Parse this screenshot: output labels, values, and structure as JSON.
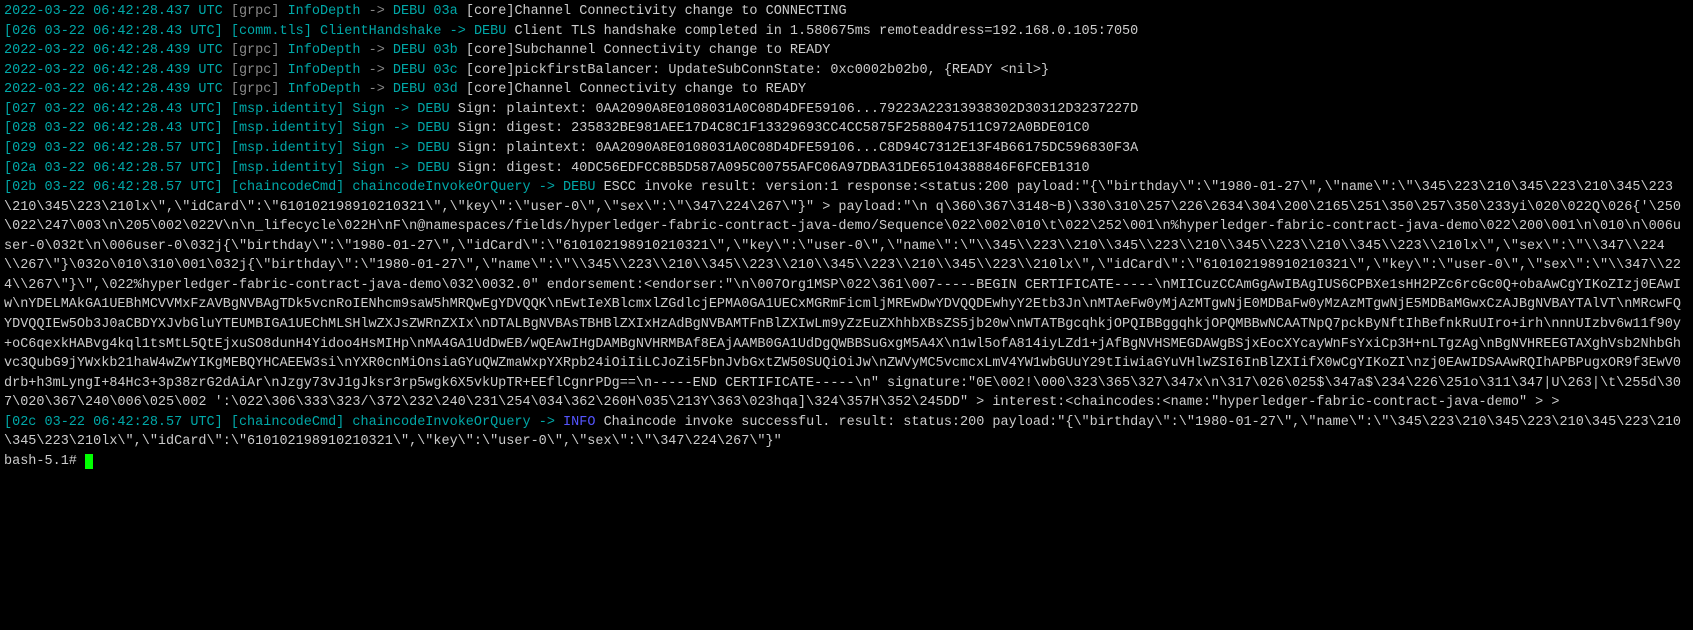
{
  "lines": [
    {
      "pre": "",
      "ts": "2022-03-22 06:42:28.437 UTC",
      "tag": "[grpc]",
      "mod": "InfoDepth",
      "arr": "->",
      "lvl": "DEBU",
      "lvlx": "03a",
      "msg": "[core]Channel Connectivity change to CONNECTING",
      "dim": false,
      "style": "norm"
    },
    {
      "pre": "[026 03-22 06:42:28.43 UTC]",
      "tag": "[comm.tls]",
      "mod": "ClientHandshake",
      "arr": "->",
      "lvl": "DEBU",
      "lvlx": "",
      "msg": "Client TLS handshake completed in 1.580675ms remoteaddress=192.168.0.105:7050",
      "style": "brk"
    },
    {
      "pre": "",
      "ts": "2022-03-22 06:42:28.439 UTC",
      "tag": "[grpc]",
      "mod": "InfoDepth",
      "arr": "->",
      "lvl": "DEBU",
      "lvlx": "03b",
      "msg": "[core]Subchannel Connectivity change to READY",
      "style": "norm"
    },
    {
      "pre": "",
      "ts": "2022-03-22 06:42:28.439 UTC",
      "tag": "[grpc]",
      "mod": "InfoDepth",
      "arr": "->",
      "lvl": "DEBU",
      "lvlx": "03c",
      "msg": "[core]pickfirstBalancer: UpdateSubConnState: 0xc0002b02b0, {READY <nil>}",
      "style": "norm"
    },
    {
      "pre": "",
      "ts": "2022-03-22 06:42:28.439 UTC",
      "tag": "[grpc]",
      "mod": "InfoDepth",
      "arr": "->",
      "lvl": "DEBU",
      "lvlx": "03d",
      "msg": "[core]Channel Connectivity change to READY",
      "style": "norm"
    },
    {
      "pre": "[027 03-22 06:42:28.43 UTC]",
      "tag": "[msp.identity]",
      "mod": "Sign",
      "arr": "->",
      "lvl": "DEBU",
      "lvlx": "",
      "msg": "Sign: plaintext: 0AA2090A8E0108031A0C08D4DFE59106...79223A22313938302D30312D3237227D",
      "style": "brk"
    },
    {
      "pre": "[028 03-22 06:42:28.43 UTC]",
      "tag": "[msp.identity]",
      "mod": "Sign",
      "arr": "->",
      "lvl": "DEBU",
      "lvlx": "",
      "msg": "Sign: digest: 235832BE981AEE17D4C8C1F13329693CC4CC5875F2588047511C972A0BDE01C0",
      "style": "brk"
    },
    {
      "pre": "[029 03-22 06:42:28.57 UTC]",
      "tag": "[msp.identity]",
      "mod": "Sign",
      "arr": "->",
      "lvl": "DEBU",
      "lvlx": "",
      "msg": "Sign: plaintext: 0AA2090A8E0108031A0C08D4DFE59106...C8D94C7312E13F4B66175DC596830F3A",
      "style": "brk"
    },
    {
      "pre": "[02a 03-22 06:42:28.57 UTC]",
      "tag": "[msp.identity]",
      "mod": "Sign",
      "arr": "->",
      "lvl": "DEBU",
      "lvlx": "",
      "msg": "Sign: digest: 40DC56EDFCC8B5D587A095C00755AFC06A97DBA31DE65104388846F6FCEB1310",
      "style": "brk"
    }
  ],
  "escc": {
    "pre": "[02b 03-22 06:42:28.57 UTC]",
    "tag": "[chaincodeCmd]",
    "mod": "chaincodeInvokeOrQuery",
    "arr": "->",
    "lvl": "DEBU",
    "msg": "ESCC invoke result: version:1 response:<status:200 payload:\"{\\\"birthday\\\":\\\"1980-01-27\\\",\\\"name\\\":\\\"\\345\\223\\210\\345\\223\\210\\345\\223\\210\\345\\223\\210lx\\\",\\\"idCard\\\":\\\"610102198910210321\\\",\\\"key\\\":\\\"user-0\\\",\\\"sex\\\":\\\"\\347\\224\\267\\\"}\" > payload:\"\\n q\\360\\367\\3148~B)\\330\\310\\257\\226\\2634\\304\\200\\2165\\251\\350\\257\\350\\233yi\\020\\022Q\\026{'\\250\\022\\247\\003\\n\\205\\002\\022V\\n\\n_lifecycle\\022H\\nF\\n@namespaces/fields/hyperledger-fabric-contract-java-demo/Sequence\\022\\002\\010\\t\\022\\252\\001\\n%hyperledger-fabric-contract-java-demo\\022\\200\\001\\n\\010\\n\\006user-0\\032t\\n\\006user-0\\032j{\\\"birthday\\\":\\\"1980-01-27\\\",\\\"idCard\\\":\\\"610102198910210321\\\",\\\"key\\\":\\\"user-0\\\",\\\"name\\\":\\\"\\\\345\\\\223\\\\210\\\\345\\\\223\\\\210\\\\345\\\\223\\\\210\\\\345\\\\223\\\\210lx\\\",\\\"sex\\\":\\\"\\\\347\\\\224\\\\267\\\"}\\032o\\010\\310\\001\\032j{\\\"birthday\\\":\\\"1980-01-27\\\",\\\"name\\\":\\\"\\\\345\\\\223\\\\210\\\\345\\\\223\\\\210\\\\345\\\\223\\\\210\\\\345\\\\223\\\\210lx\\\",\\\"idCard\\\":\\\"610102198910210321\\\",\\\"key\\\":\\\"user-0\\\",\\\"sex\\\":\\\"\\\\347\\\\224\\\\267\\\"}\\\",\\022%hyperledger-fabric-contract-java-demo\\032\\0032.0\" endorsement:<endorser:\"\\n\\007Org1MSP\\022\\361\\007-----BEGIN CERTIFICATE-----\\nMIICuzCCAmGgAwIBAgIUS6CPBXe1sHH2PZc6rcGc0Q+obaAwCgYIKoZIzj0EAwIw\\nYDELMAkGA1UEBhMCVVMxFzAVBgNVBAgTDk5vcnRoIENhcm9saW5hMRQwEgYDVQQK\\nEwtIeXBlcmxlZGdlcjEPMA0GA1UECxMGRmFicmljMREwDwYDVQQDEwhyY2Etb3Jn\\nMTAeFw0yMjAzMTgwNjE0MDBaFw0yMzAzMTgwNjE5MDBaMGwxCzAJBgNVBAYTAlVT\\nMRcwFQYDVQQIEw5Ob3J0aCBDYXJvbGluYTEUMBIGA1UEChMLSHlwZXJsZWRnZXIx\\nDTALBgNVBAsTBHBlZXIxHzAdBgNVBAMTFnBlZXIwLm9yZzEuZXhhbXBsZS5jb20w\\nWTATBgcqhkjOPQIBBggqhkjOPQMBBwNCAATNpQ7pckByNftIhBefnkRuUIro+irh\\nnnUIzbv6w11f90y+oC6qexkHABvg4kql1tsMtL5QtEjxuSO8dunH4Yidoo4HsMIHp\\nMA4GA1UdDwEB/wQEAwIHgDAMBgNVHRMBAf8EAjAAMB0GA1UdDgQWBBSuGxgM5A4X\\n1wl5ofA814iyLZd1+jAfBgNVHSMEGDAWgBSjxEocXYcayWnFsYxiCp3H+nLTgzAg\\nBgNVHREEGTAXghVsb2NhbGhvc3QubG9jYWxkb21haW4wZwYIKgMEBQYHCAEEW3si\\nYXR0cnMiOnsiaGYuQWZmaWxpYXRpb24iOiIiLCJoZi5FbnJvbGxtZW50SUQiOiJw\\nZWVyMC5vcmcxLmV4YW1wbGUuY29tIiwiaGYuVHlwZSI6InBlZXIifX0wCgYIKoZI\\nzj0EAwIDSAAwRQIhAPBPugxOR9f3EwV0drb+h3mLyngI+84Hc3+3p38zrG2dAiAr\\nJzgy73vJ1gJksr3rp5wgk6X5vkUpTR+EEflCgnrPDg==\\n-----END CERTIFICATE-----\\n\" signature:\"0E\\002!\\000\\323\\365\\327\\347x\\n\\317\\026\\025$\\347a$\\234\\226\\251o\\311\\347|U\\263|\\t\\255d\\307\\020\\367\\240\\006\\025\\002 ':\\022\\306\\333\\323/\\372\\232\\240\\231\\254\\034\\362\\260H\\035\\213Y\\363\\023hqa]\\324\\357H\\352\\245DD\" > interest:<chaincodes:<name:\"hyperledger-fabric-contract-java-demo\" > >"
  },
  "final": {
    "pre": "[02c 03-22 06:42:28.57 UTC]",
    "tag": "[chaincodeCmd]",
    "mod": "chaincodeInvokeOrQuery",
    "arr": "->",
    "lvl": "INFO",
    "msg": "Chaincode invoke successful. result: status:200 payload:\"{\\\"birthday\\\":\\\"1980-01-27\\\",\\\"name\\\":\\\"\\345\\223\\210\\345\\223\\210\\345\\223\\210\\345\\223\\210lx\\\",\\\"idCard\\\":\\\"610102198910210321\\\",\\\"key\\\":\\\"user-0\\\",\\\"sex\\\":\\\"\\347\\224\\267\\\"}\""
  },
  "prompt": "bash-5.1# "
}
